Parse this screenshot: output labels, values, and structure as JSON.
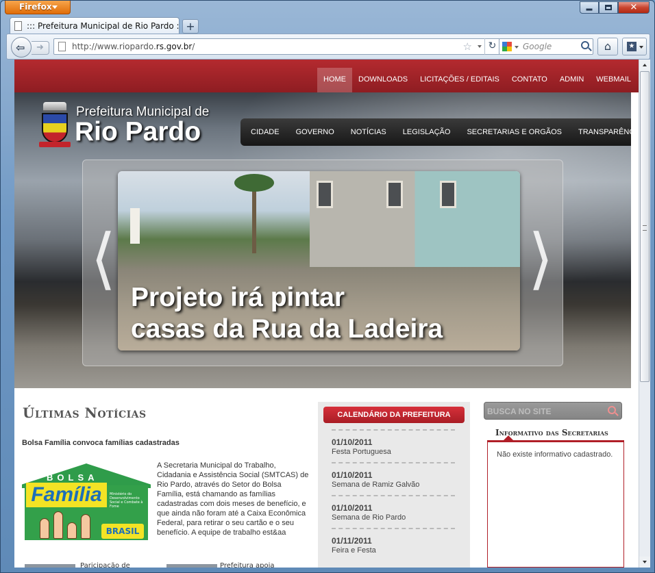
{
  "browser": {
    "app_button": "Firefox",
    "tab_title": "::: Prefeitura Municipal de Rio Pardo :::",
    "new_tab": "+",
    "url_prefix": "http://www.riopardo.",
    "url_domain": "rs.gov.br",
    "url_suffix": "/",
    "search_placeholder": "Google"
  },
  "site": {
    "top_nav": [
      "HOME",
      "DOWNLOADS",
      "LICITAÇÕES / EDITAIS",
      "CONTATO",
      "ADMIN",
      "WEBMAIL"
    ],
    "logo_line1": "Prefeitura Municipal de",
    "logo_line2": "Rio Pardo",
    "main_nav": [
      "CIDADE",
      "GOVERNO",
      "NOTÍCIAS",
      "LEGISLAÇÃO",
      "SECRETARIAS E ORGÃOS",
      "TRANSPARÊNCIA"
    ],
    "slide_caption_line1": "Projeto irá pintar",
    "slide_caption_line2": "casas da Rua da Ladeira",
    "slide_prev": "❬",
    "slide_next": "❭"
  },
  "news": {
    "section_title": "Últimas Notícias",
    "headline": "Bolsa Família convoca famílias cadastradas",
    "body": "A Secretaria Municipal do Trabalho, Cidadania e Assistência Social (SMTCAS) de Rio Pardo, através do Setor do Bolsa Família, está chamando as famílias cadastradas com dois meses de benefício, e que ainda não foram até a Caixa Econômica Federal, para retirar o seu cartão e o seu benefício. A equipe de trabalho est&aa",
    "image": {
      "word1": "BOLSA",
      "word2": "Família",
      "small": "Ministério do Desenvolvimento Social e Combate à Fome",
      "brasil": "BRASIL"
    },
    "next1": "Paricipação de",
    "next2": "Prefeitura apoia"
  },
  "calendar": {
    "title": "CALENDÁRIO DA PREFEITURA",
    "items": [
      {
        "date": "01/10/2011",
        "event": "Festa Portuguesa"
      },
      {
        "date": "01/10/2011",
        "event": "Semana de Ramiz Galvão"
      },
      {
        "date": "01/10/2011",
        "event": "Semana de Rio Pardo"
      },
      {
        "date": "01/11/2011",
        "event": "Feira e Festa"
      }
    ]
  },
  "sidebar": {
    "search_placeholder": "BUSCA NO SITE",
    "info_title": "Informativo das Secretarias",
    "info_empty": "Não existe informativo cadastrado."
  },
  "colors": {
    "brand_red": "#a91d25",
    "nav_dark": "#1f1f1f"
  }
}
